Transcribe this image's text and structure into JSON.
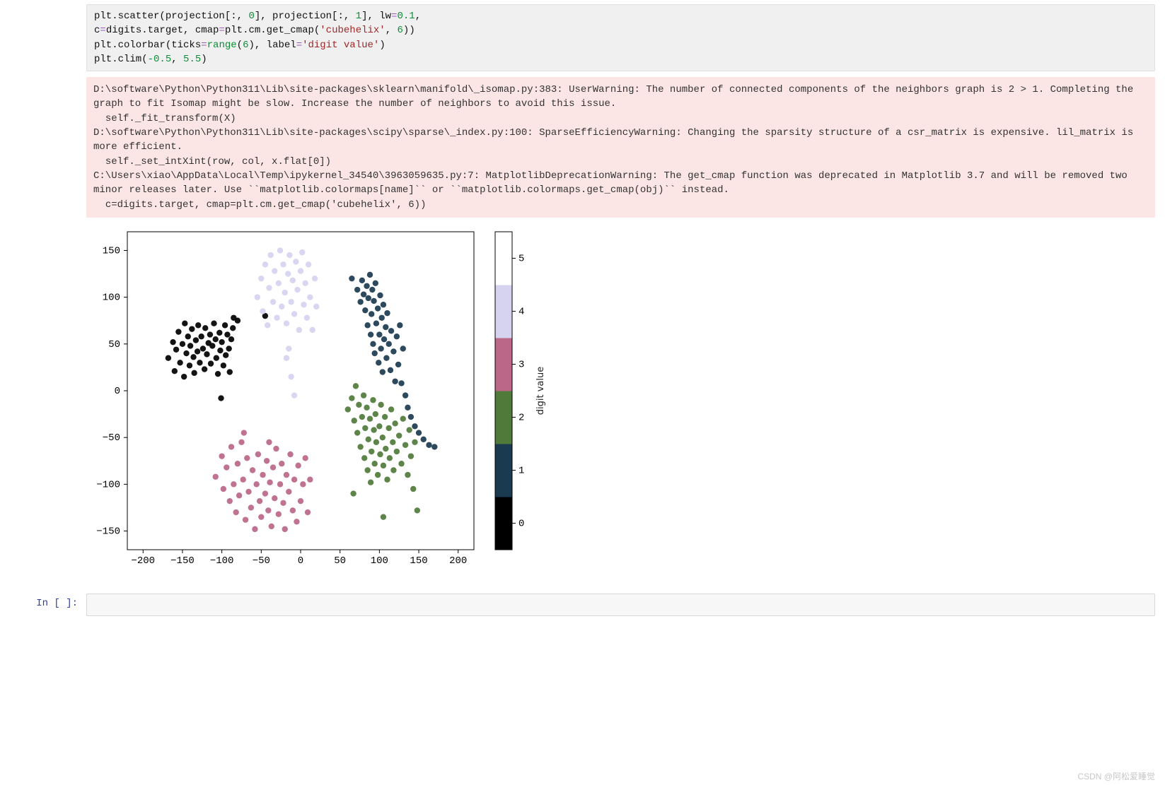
{
  "code": {
    "l1a": "plt.scatter(projection[:, ",
    "l1n0": "0",
    "l1b": "], projection[:, ",
    "l1n1": "1",
    "l1c": "], lw",
    "l1eq": "=",
    "l1n2": "0.1",
    "l1d": ",",
    "l2a": "c",
    "l2eq": "=",
    "l2b": "digits.target, cmap",
    "l2eq2": "=",
    "l2c": "plt.cm.get_cmap(",
    "l2s": "'cubehelix'",
    "l2d": ", ",
    "l2n": "6",
    "l2e": "))",
    "l3a": "plt.colorbar(ticks",
    "l3eq": "=",
    "l3kw": "range",
    "l3b": "(",
    "l3n": "6",
    "l3c": "), label",
    "l3eq2": "=",
    "l3s": "'digit value'",
    "l3d": ")",
    "l4a": "plt.clim(",
    "l4n1": "-0.5",
    "l4b": ", ",
    "l4n2": "5.5",
    "l4c": ")"
  },
  "warnings": "D:\\software\\Python\\Python311\\Lib\\site-packages\\sklearn\\manifold\\_isomap.py:383: UserWarning: The number of connected components of the neighbors graph is 2 > 1. Completing the graph to fit Isomap might be slow. Increase the number of neighbors to avoid this issue.\n  self._fit_transform(X)\nD:\\software\\Python\\Python311\\Lib\\site-packages\\scipy\\sparse\\_index.py:100: SparseEfficiencyWarning: Changing the sparsity structure of a csr_matrix is expensive. lil_matrix is more efficient.\n  self._set_intXint(row, col, x.flat[0])\nC:\\Users\\xiao\\AppData\\Local\\Temp\\ipykernel_34540\\3963059635.py:7: MatplotlibDeprecationWarning: The get_cmap function was deprecated in Matplotlib 3.7 and will be removed two minor releases later. Use ``matplotlib.colormaps[name]`` or ``matplotlib.colormaps.get_cmap(obj)`` instead.\n  c=digits.target, cmap=plt.cm.get_cmap('cubehelix', 6))",
  "next_prompt": "In [ ]:",
  "watermark": "CSDN @阿松爱睡觉",
  "chart_data": {
    "type": "scatter",
    "xlabel": "",
    "ylabel": "",
    "xlim": [
      -220,
      220
    ],
    "ylim": [
      -170,
      170
    ],
    "xticks": [
      -200,
      -150,
      -100,
      -50,
      0,
      50,
      100,
      150,
      200
    ],
    "yticks": [
      -150,
      -100,
      -50,
      0,
      50,
      100,
      150
    ],
    "colorbar": {
      "label": "digit value",
      "ticks": [
        0,
        1,
        2,
        3,
        4,
        5
      ],
      "vmin": -0.5,
      "vmax": 5.5,
      "cmap": [
        "#000000",
        "#1a3a4f",
        "#4f7a3a",
        "#bb6788",
        "#d5d3ef",
        "#ffffff"
      ]
    },
    "series": [
      {
        "name": "0",
        "color": "#000000",
        "points": [
          [
            -168,
            35
          ],
          [
            -162,
            52
          ],
          [
            -160,
            21
          ],
          [
            -158,
            44
          ],
          [
            -155,
            63
          ],
          [
            -153,
            30
          ],
          [
            -150,
            50
          ],
          [
            -148,
            15
          ],
          [
            -147,
            72
          ],
          [
            -145,
            40
          ],
          [
            -143,
            58
          ],
          [
            -141,
            27
          ],
          [
            -140,
            48
          ],
          [
            -138,
            66
          ],
          [
            -136,
            36
          ],
          [
            -135,
            19
          ],
          [
            -133,
            54
          ],
          [
            -131,
            42
          ],
          [
            -130,
            70
          ],
          [
            -128,
            30
          ],
          [
            -126,
            58
          ],
          [
            -124,
            45
          ],
          [
            -122,
            23
          ],
          [
            -121,
            67
          ],
          [
            -119,
            39
          ],
          [
            -117,
            51
          ],
          [
            -115,
            60
          ],
          [
            -114,
            29
          ],
          [
            -112,
            48
          ],
          [
            -110,
            72
          ],
          [
            -108,
            55
          ],
          [
            -107,
            35
          ],
          [
            -105,
            18
          ],
          [
            -103,
            62
          ],
          [
            -102,
            43
          ],
          [
            -100,
            52
          ],
          [
            -98,
            27
          ],
          [
            -96,
            70
          ],
          [
            -95,
            38
          ],
          [
            -93,
            60
          ],
          [
            -91,
            45
          ],
          [
            -90,
            20
          ],
          [
            -88,
            55
          ],
          [
            -86,
            67
          ],
          [
            -101,
            -8
          ],
          [
            -85,
            78
          ],
          [
            -80,
            75
          ],
          [
            -45,
            80
          ]
        ]
      },
      {
        "name": "1",
        "color": "#1a3a4f",
        "points": [
          [
            65,
            120
          ],
          [
            72,
            108
          ],
          [
            76,
            95
          ],
          [
            78,
            118
          ],
          [
            80,
            103
          ],
          [
            82,
            86
          ],
          [
            84,
            112
          ],
          [
            85,
            70
          ],
          [
            86,
            99
          ],
          [
            88,
            124
          ],
          [
            89,
            60
          ],
          [
            90,
            82
          ],
          [
            91,
            108
          ],
          [
            92,
            50
          ],
          [
            93,
            96
          ],
          [
            94,
            40
          ],
          [
            95,
            115
          ],
          [
            96,
            72
          ],
          [
            98,
            88
          ],
          [
            99,
            30
          ],
          [
            100,
            60
          ],
          [
            101,
            102
          ],
          [
            102,
            45
          ],
          [
            103,
            78
          ],
          [
            104,
            20
          ],
          [
            105,
            92
          ],
          [
            106,
            55
          ],
          [
            108,
            68
          ],
          [
            109,
            35
          ],
          [
            110,
            83
          ],
          [
            112,
            50
          ],
          [
            114,
            22
          ],
          [
            115,
            64
          ],
          [
            118,
            42
          ],
          [
            120,
            10
          ],
          [
            122,
            58
          ],
          [
            124,
            28
          ],
          [
            126,
            70
          ],
          [
            128,
            8
          ],
          [
            130,
            45
          ],
          [
            133,
            -5
          ],
          [
            136,
            -18
          ],
          [
            140,
            -28
          ],
          [
            145,
            -38
          ],
          [
            150,
            -45
          ],
          [
            156,
            -52
          ],
          [
            163,
            -58
          ],
          [
            170,
            -60
          ]
        ]
      },
      {
        "name": "2",
        "color": "#4f7a3a",
        "points": [
          [
            60,
            -20
          ],
          [
            65,
            -8
          ],
          [
            68,
            -32
          ],
          [
            70,
            5
          ],
          [
            72,
            -45
          ],
          [
            74,
            -15
          ],
          [
            76,
            -60
          ],
          [
            78,
            -28
          ],
          [
            80,
            -5
          ],
          [
            81,
            -72
          ],
          [
            82,
            -40
          ],
          [
            84,
            -18
          ],
          [
            85,
            -85
          ],
          [
            86,
            -52
          ],
          [
            88,
            -30
          ],
          [
            89,
            -98
          ],
          [
            90,
            -65
          ],
          [
            92,
            -10
          ],
          [
            93,
            -42
          ],
          [
            94,
            -78
          ],
          [
            95,
            -25
          ],
          [
            96,
            -55
          ],
          [
            98,
            -90
          ],
          [
            100,
            -38
          ],
          [
            101,
            -68
          ],
          [
            102,
            -15
          ],
          [
            104,
            -50
          ],
          [
            105,
            -80
          ],
          [
            107,
            -28
          ],
          [
            108,
            -62
          ],
          [
            110,
            -95
          ],
          [
            112,
            -40
          ],
          [
            113,
            -72
          ],
          [
            115,
            -20
          ],
          [
            117,
            -55
          ],
          [
            118,
            -85
          ],
          [
            120,
            -35
          ],
          [
            122,
            -65
          ],
          [
            125,
            -48
          ],
          [
            128,
            -78
          ],
          [
            130,
            -30
          ],
          [
            133,
            -58
          ],
          [
            136,
            -90
          ],
          [
            138,
            -42
          ],
          [
            140,
            -70
          ],
          [
            143,
            -105
          ],
          [
            145,
            -55
          ],
          [
            148,
            -128
          ],
          [
            67,
            -110
          ],
          [
            105,
            -135
          ]
        ]
      },
      {
        "name": "3",
        "color": "#bb6788",
        "points": [
          [
            -108,
            -92
          ],
          [
            -100,
            -70
          ],
          [
            -98,
            -105
          ],
          [
            -94,
            -82
          ],
          [
            -90,
            -118
          ],
          [
            -88,
            -60
          ],
          [
            -85,
            -100
          ],
          [
            -82,
            -130
          ],
          [
            -80,
            -78
          ],
          [
            -78,
            -112
          ],
          [
            -75,
            -55
          ],
          [
            -73,
            -95
          ],
          [
            -70,
            -138
          ],
          [
            -68,
            -72
          ],
          [
            -66,
            -108
          ],
          [
            -63,
            -125
          ],
          [
            -61,
            -85
          ],
          [
            -58,
            -148
          ],
          [
            -56,
            -100
          ],
          [
            -54,
            -68
          ],
          [
            -52,
            -118
          ],
          [
            -50,
            -135
          ],
          [
            -48,
            -90
          ],
          [
            -45,
            -110
          ],
          [
            -43,
            -75
          ],
          [
            -41,
            -128
          ],
          [
            -39,
            -98
          ],
          [
            -37,
            -145
          ],
          [
            -35,
            -82
          ],
          [
            -33,
            -115
          ],
          [
            -31,
            -62
          ],
          [
            -28,
            -132
          ],
          [
            -26,
            -100
          ],
          [
            -24,
            -78
          ],
          [
            -22,
            -120
          ],
          [
            -20,
            -148
          ],
          [
            -18,
            -90
          ],
          [
            -15,
            -108
          ],
          [
            -13,
            -68
          ],
          [
            -10,
            -128
          ],
          [
            -8,
            -95
          ],
          [
            -5,
            -140
          ],
          [
            -3,
            -80
          ],
          [
            0,
            -118
          ],
          [
            3,
            -100
          ],
          [
            6,
            -72
          ],
          [
            9,
            -130
          ],
          [
            12,
            -95
          ],
          [
            -72,
            -45
          ],
          [
            -40,
            -55
          ]
        ]
      },
      {
        "name": "4",
        "color": "#d5d3ef",
        "points": [
          [
            -55,
            100
          ],
          [
            -50,
            120
          ],
          [
            -48,
            85
          ],
          [
            -45,
            135
          ],
          [
            -42,
            70
          ],
          [
            -40,
            110
          ],
          [
            -38,
            145
          ],
          [
            -35,
            95
          ],
          [
            -33,
            128
          ],
          [
            -30,
            78
          ],
          [
            -28,
            115
          ],
          [
            -26,
            150
          ],
          [
            -24,
            90
          ],
          [
            -22,
            135
          ],
          [
            -20,
            105
          ],
          [
            -18,
            72
          ],
          [
            -16,
            125
          ],
          [
            -14,
            145
          ],
          [
            -12,
            95
          ],
          [
            -10,
            118
          ],
          [
            -8,
            82
          ],
          [
            -6,
            138
          ],
          [
            -4,
            108
          ],
          [
            -2,
            65
          ],
          [
            0,
            128
          ],
          [
            2,
            148
          ],
          [
            4,
            92
          ],
          [
            6,
            115
          ],
          [
            8,
            78
          ],
          [
            10,
            135
          ],
          [
            12,
            100
          ],
          [
            15,
            65
          ],
          [
            18,
            120
          ],
          [
            20,
            90
          ],
          [
            -15,
            45
          ],
          [
            -18,
            35
          ],
          [
            -12,
            15
          ],
          [
            -8,
            -5
          ]
        ]
      },
      {
        "name": "5",
        "color": "#ffffff",
        "points": []
      }
    ]
  }
}
